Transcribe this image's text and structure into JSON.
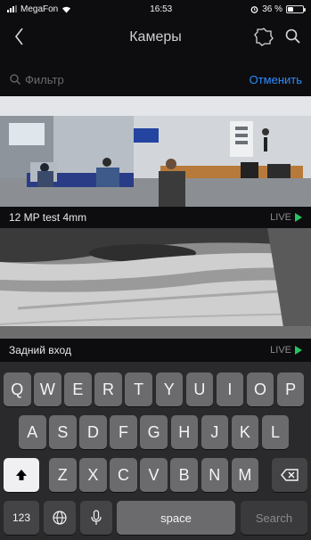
{
  "status": {
    "carrier": "MegaFon",
    "time": "16:53",
    "battery_text": "36 %",
    "battery_level": 0.36
  },
  "nav": {
    "title": "Камеры",
    "back_icon": "chevron-left-icon",
    "cams_icon": "camera-group-icon",
    "search_icon": "search-icon"
  },
  "filter": {
    "placeholder": "Фильтр",
    "cancel": "Отменить"
  },
  "cameras": [
    {
      "name": "12 MP test 4mm",
      "status": "LIVE"
    },
    {
      "name": "Задний вход",
      "status": "LIVE"
    }
  ],
  "keyboard": {
    "row1": [
      "Q",
      "W",
      "E",
      "R",
      "T",
      "Y",
      "U",
      "I",
      "O",
      "P"
    ],
    "row2": [
      "A",
      "S",
      "D",
      "F",
      "G",
      "H",
      "J",
      "K",
      "L"
    ],
    "row3": [
      "Z",
      "X",
      "C",
      "V",
      "B",
      "N",
      "M"
    ],
    "num": "123",
    "space": "space",
    "action": "Search",
    "globe_icon": "globe-icon",
    "mic_icon": "microphone-icon",
    "shift_icon": "shift-icon",
    "backspace_icon": "backspace-icon"
  },
  "colors": {
    "accent": "#2d8cff",
    "live": "#22c55e",
    "background": "#0d0d0f"
  }
}
